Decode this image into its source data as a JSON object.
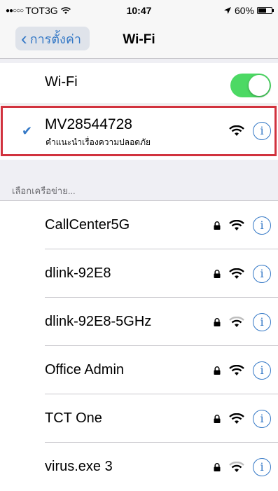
{
  "status_bar": {
    "signal": "●●○○○",
    "carrier": "TOT3G",
    "wifi_icon": "wifi-icon",
    "time": "10:47",
    "location_icon": "location-arrow-icon",
    "battery_text": "60%",
    "battery_level": 0.6
  },
  "nav": {
    "back_label": "การตั้งค่า",
    "title": "Wi-Fi"
  },
  "wifi_toggle": {
    "label": "Wi-Fi",
    "on": true,
    "on_color": "#4cd964"
  },
  "connected_network": {
    "name": "MV28544728",
    "subtitle": "คำแนะนำเรื่องความปลอดภัย",
    "check_icon": "checkmark-icon",
    "highlight_color": "#d1323e"
  },
  "section_header": "เลือกเครือข่าย...",
  "networks": [
    {
      "name": "CallCenter5G",
      "locked": true,
      "signal": "full"
    },
    {
      "name": "dlink-92E8",
      "locked": true,
      "signal": "full"
    },
    {
      "name": "dlink-92E8-5GHz",
      "locked": true,
      "signal": "weak"
    },
    {
      "name": "Office Admin",
      "locked": true,
      "signal": "full"
    },
    {
      "name": "TCT One",
      "locked": true,
      "signal": "full"
    },
    {
      "name": "virus.exe 3",
      "locked": true,
      "signal": "weak"
    }
  ],
  "colors": {
    "accent": "#3478c6",
    "background": "#efeff4",
    "separator": "#c8c7cc"
  }
}
